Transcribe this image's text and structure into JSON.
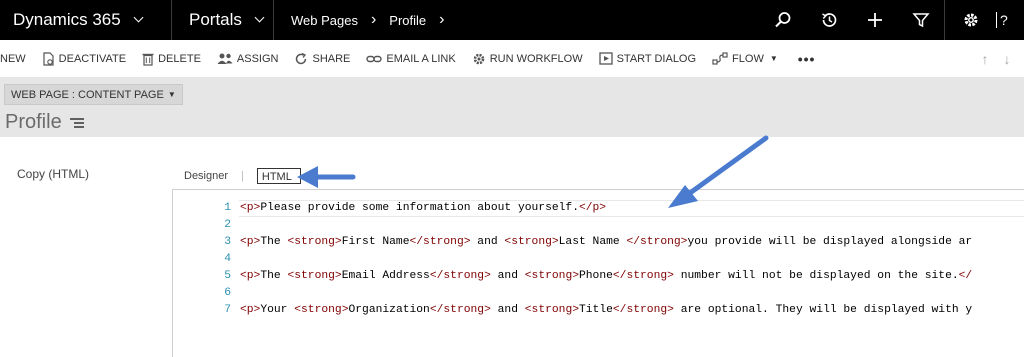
{
  "topbar": {
    "app_title": "Dynamics 365",
    "area_title": "Portals",
    "breadcrumbs": [
      "Web Pages",
      "Profile"
    ],
    "icons": [
      "search-icon",
      "history-icon",
      "plus-icon",
      "filter-icon",
      "settings-icon",
      "help-icon"
    ],
    "help_label": "?"
  },
  "commands": [
    {
      "label": "NEW",
      "icon": ""
    },
    {
      "label": "DEACTIVATE",
      "icon": "deactivate-icon"
    },
    {
      "label": "DELETE",
      "icon": "trash-icon"
    },
    {
      "label": "ASSIGN",
      "icon": "assign-icon"
    },
    {
      "label": "SHARE",
      "icon": "share-icon"
    },
    {
      "label": "EMAIL A LINK",
      "icon": "link-icon"
    },
    {
      "label": "RUN WORKFLOW",
      "icon": "workflow-icon"
    },
    {
      "label": "START DIALOG",
      "icon": "dialog-icon"
    },
    {
      "label": "FLOW",
      "icon": "flow-icon"
    }
  ],
  "more_label": "•••",
  "form_header": {
    "form_selector": "WEB PAGE : CONTENT PAGE",
    "record_title": "Profile"
  },
  "field": {
    "label": "Copy (HTML)",
    "tab_designer": "Designer",
    "tab_separator": "|",
    "tab_html": "HTML"
  },
  "editor": {
    "lines": [
      {
        "n": "1",
        "code": "<p>Please provide some information about yourself.</p>"
      },
      {
        "n": "2",
        "code": ""
      },
      {
        "n": "3",
        "code": "<p>The <strong>First Name</strong> and <strong>Last Name </strong>you provide will be displayed alongside ar"
      },
      {
        "n": "4",
        "code": ""
      },
      {
        "n": "5",
        "code": "<p>The <strong>Email Address</strong> and <strong>Phone</strong> number will not be displayed on the site.</"
      },
      {
        "n": "6",
        "code": ""
      },
      {
        "n": "7",
        "code": "<p>Your <strong>Organization</strong> and <strong>Title</strong> are optional. They will be displayed with y"
      }
    ]
  },
  "colors": {
    "topbar": "#000000",
    "annotation_arrow": "#4a7bcf",
    "line_number": "#2b91af",
    "html_tag": "#800000"
  }
}
